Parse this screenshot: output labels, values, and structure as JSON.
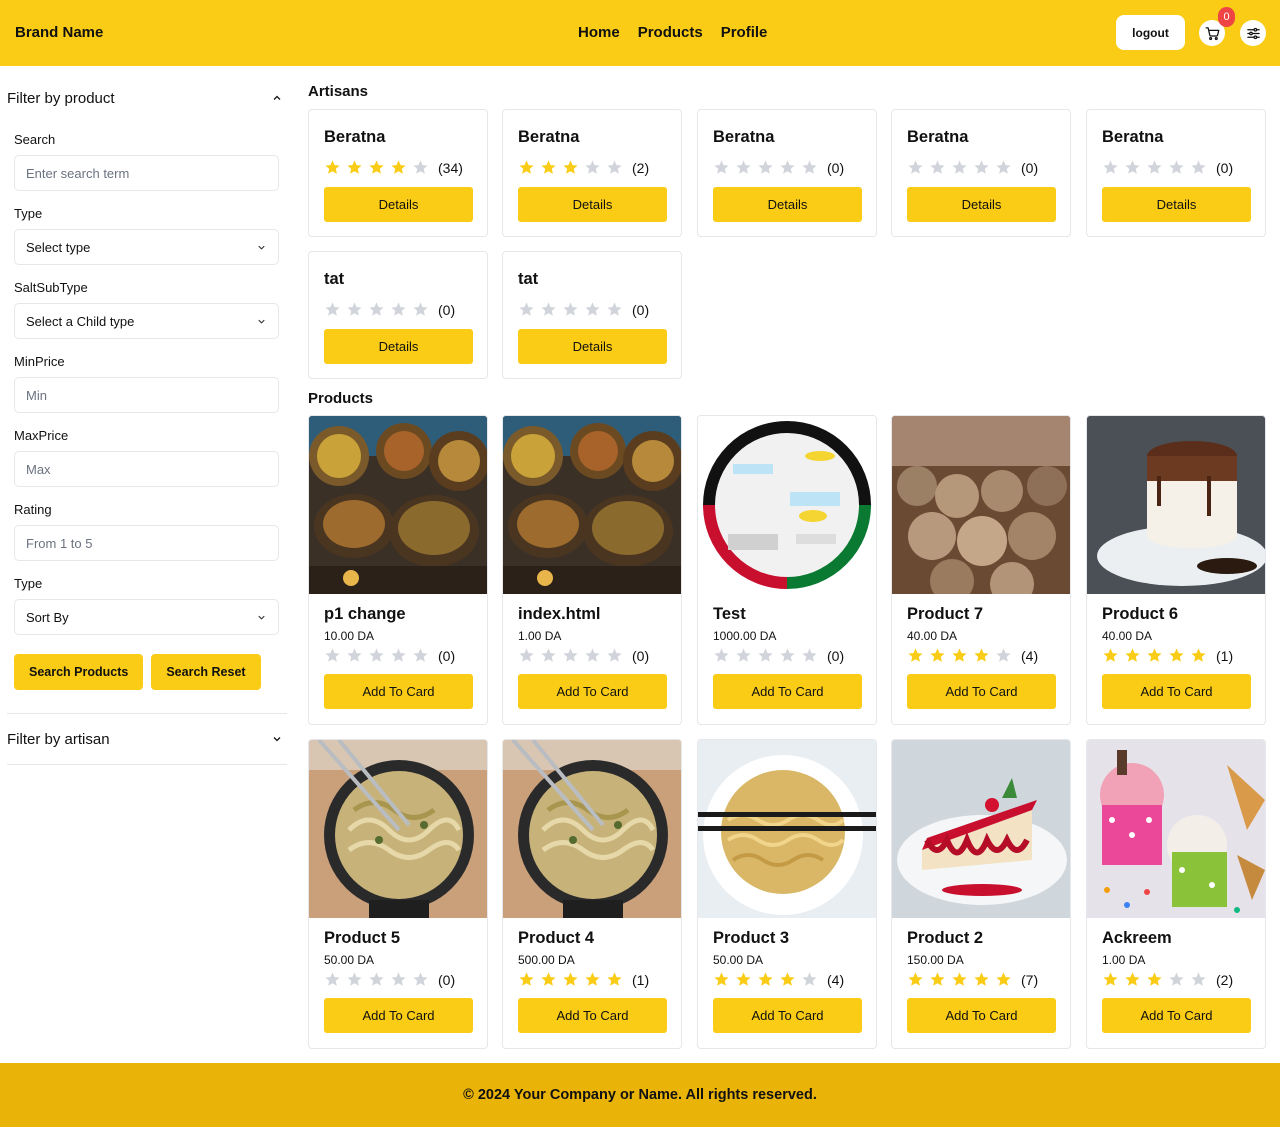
{
  "header": {
    "brand": "Brand Name",
    "nav": [
      "Home",
      "Products",
      "Profile"
    ],
    "logout": "logout",
    "cart_count": "0",
    "accent": "#facc15"
  },
  "sidebar": {
    "product_filter_title": "Filter by product",
    "search_label": "Search",
    "search_placeholder": "Enter search term",
    "type_label": "Type",
    "type_value": "Select type",
    "subtype_label": "SaltSubType",
    "subtype_value": "Select a Child type",
    "minprice_label": "MinPrice",
    "minprice_placeholder": "Min",
    "maxprice_label": "MaxPrice",
    "maxprice_placeholder": "Max",
    "rating_label": "Rating",
    "rating_placeholder": "From 1 to 5",
    "sort_label": "Type",
    "sort_value": "Sort By",
    "search_button": "Search Products",
    "reset_button": "Search Reset",
    "artisan_filter_title": "Filter by artisan"
  },
  "artisans_title": "Artisans",
  "artisan_button": "Details",
  "artisans": [
    {
      "name": "Beratna",
      "rating": 4,
      "count": "(34)"
    },
    {
      "name": "Beratna",
      "rating": 3,
      "count": "(2)"
    },
    {
      "name": "Beratna",
      "rating": 0,
      "count": "(0)"
    },
    {
      "name": "Beratna",
      "rating": 0,
      "count": "(0)"
    },
    {
      "name": "Beratna",
      "rating": 0,
      "count": "(0)"
    },
    {
      "name": "tat",
      "rating": 0,
      "count": "(0)"
    },
    {
      "name": "tat",
      "rating": 0,
      "count": "(0)"
    }
  ],
  "products_title": "Products",
  "product_button": "Add To Card",
  "products": [
    {
      "name": "p1 change",
      "price": "10.00 DA",
      "rating": 0,
      "count": "(0)",
      "image": "food-market-bowls"
    },
    {
      "name": "index.html",
      "price": "1.00 DA",
      "rating": 0,
      "count": "(0)",
      "image": "food-market-bowls"
    },
    {
      "name": "Test",
      "price": "1000.00 DA",
      "rating": 0,
      "count": "(0)",
      "image": "diagram-circle"
    },
    {
      "name": "Product 7",
      "price": "40.00 DA",
      "rating": 4,
      "count": "(4)",
      "image": "truffles"
    },
    {
      "name": "Product 6",
      "price": "40.00 DA",
      "rating": 5,
      "count": "(1)",
      "image": "chocolate-cake"
    },
    {
      "name": "Product 5",
      "price": "50.00 DA",
      "rating": 0,
      "count": "(0)",
      "image": "pasta-pan"
    },
    {
      "name": "Product 4",
      "price": "500.00 DA",
      "rating": 5,
      "count": "(1)",
      "image": "pasta-pan"
    },
    {
      "name": "Product 3",
      "price": "50.00 DA",
      "rating": 4,
      "count": "(4)",
      "image": "noodle-bowl"
    },
    {
      "name": "Product 2",
      "price": "150.00 DA",
      "rating": 5,
      "count": "(7)",
      "image": "cheesecake"
    },
    {
      "name": "Ackreem",
      "price": "1.00 DA",
      "rating": 3,
      "count": "(2)",
      "image": "ice-cream"
    }
  ],
  "footer": "© 2024 Your Company or Name. All rights reserved."
}
